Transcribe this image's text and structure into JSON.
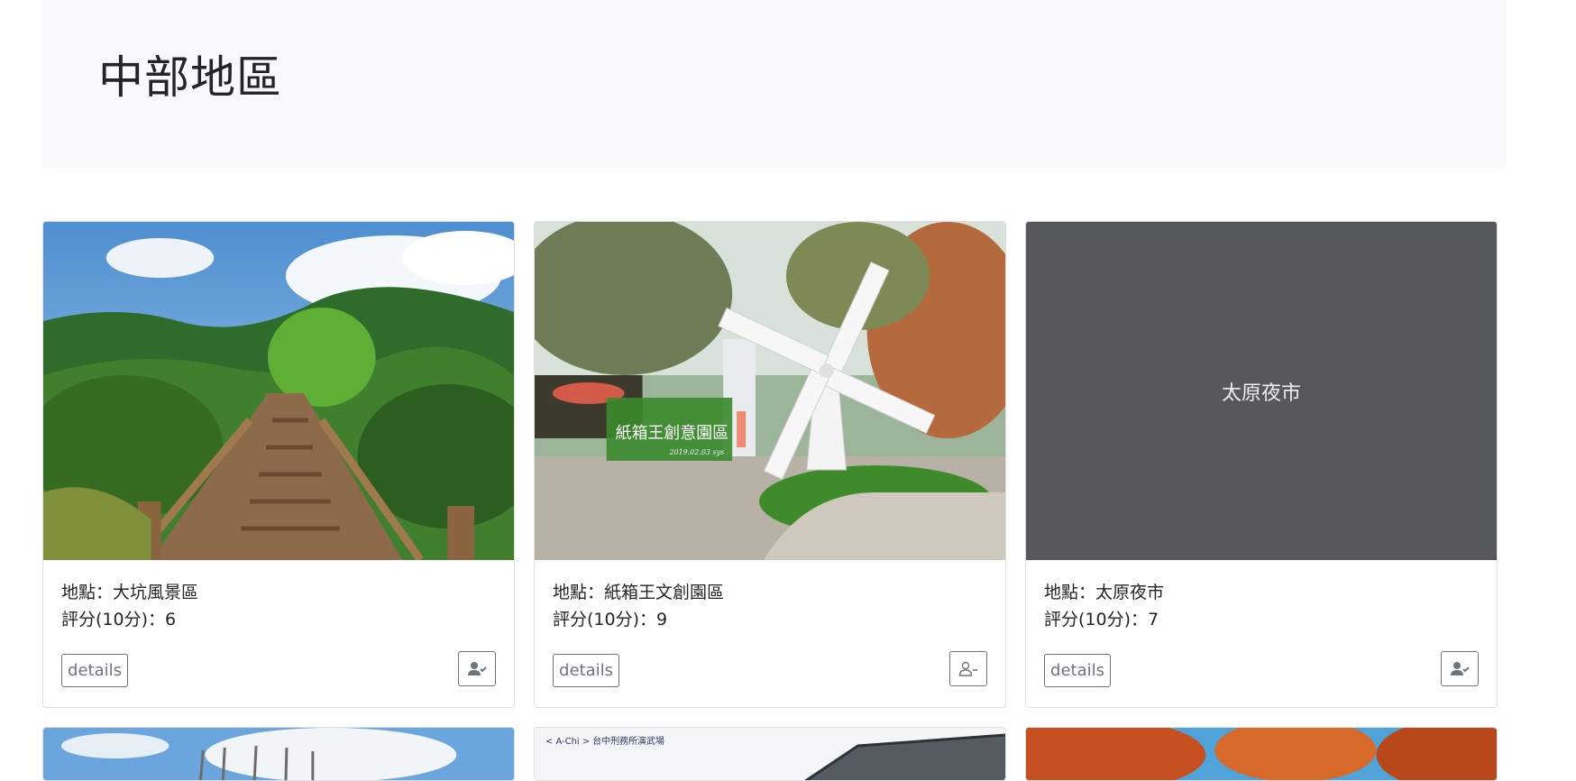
{
  "page": {
    "title": "中部地區"
  },
  "cards": [
    {
      "image_alt": "大坑風景區",
      "location_text": "地點：大坑風景區",
      "rating_text": "評分(10分)：6",
      "details_label": "details",
      "follow_icon": "user-check-icon"
    },
    {
      "image_alt": "紙箱王文創園區",
      "image_overlay_title": "紙箱王創意園區",
      "image_overlay_date": "2019.02.03 sys",
      "location_text": "地點：紙箱王文創園區",
      "rating_text": "評分(10分)：9",
      "details_label": "details",
      "follow_icon": "user-minus-icon"
    },
    {
      "image_alt": "太原夜市",
      "placeholder_text": "太原夜市",
      "location_text": "地點：太原夜市",
      "rating_text": "評分(10分)：7",
      "details_label": "details",
      "follow_icon": "user-check-icon"
    }
  ],
  "next_row": [
    {
      "image_alt": "sky-photo"
    },
    {
      "image_caption": "< A-Chi > 台中刑務所演武場"
    },
    {
      "image_alt": "autumn-trees-photo"
    }
  ]
}
